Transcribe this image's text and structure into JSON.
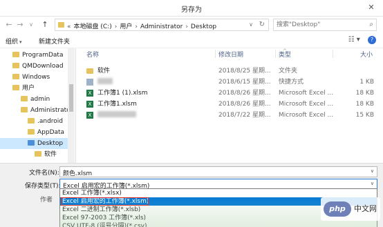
{
  "window": {
    "title": "另存为",
    "close_glyph": "✕"
  },
  "nav": {
    "back_glyph": "←",
    "forward_glyph": "→",
    "recent_glyph": "∨",
    "up_glyph": "↑",
    "address_parts": [
      "«",
      "本地磁盘 (C:)",
      "›",
      "用户",
      "›",
      "Administrator",
      "›",
      "Desktop"
    ],
    "address_dropdown_glyph": "∨",
    "refresh_glyph": "↻",
    "search_placeholder": "搜索\"Desktop\"",
    "search_glyph": "⌕"
  },
  "toolbar": {
    "organize_label": "组织",
    "new_folder_label": "新建文件夹",
    "caret": "▾",
    "view_glyph": "☷ ▾",
    "help_glyph": "?"
  },
  "tree": [
    {
      "label": "ProgramData",
      "level": 1,
      "selected": false,
      "blue": false,
      "chev": ""
    },
    {
      "label": "QMDownload",
      "level": 1,
      "selected": false,
      "blue": false,
      "chev": ""
    },
    {
      "label": "Windows",
      "level": 1,
      "selected": false,
      "blue": false,
      "chev": ""
    },
    {
      "label": "用户",
      "level": 1,
      "selected": false,
      "blue": false,
      "chev": ""
    },
    {
      "label": "admin",
      "level": 2,
      "selected": false,
      "blue": false,
      "chev": ""
    },
    {
      "label": "Administrato",
      "level": 2,
      "selected": false,
      "blue": false,
      "chev": ""
    },
    {
      "label": ".android",
      "level": 3,
      "selected": false,
      "blue": false,
      "chev": ""
    },
    {
      "label": "AppData",
      "level": 3,
      "selected": false,
      "blue": false,
      "chev": ""
    },
    {
      "label": "Desktop",
      "level": 3,
      "selected": true,
      "blue": true,
      "chev": ""
    },
    {
      "label": "软件",
      "level": 4,
      "selected": false,
      "blue": false,
      "chev": ""
    }
  ],
  "columns": {
    "name": "名称",
    "date": "修改日期",
    "type": "类型",
    "size": "大小",
    "collapse_glyph": "^"
  },
  "files": [
    {
      "icon": "folder",
      "name": "软件",
      "blurred_name": false,
      "date": "2018/8/25 星期...",
      "type": "文件夹",
      "size": ""
    },
    {
      "icon": "shortcut",
      "name": "",
      "blurred_name": true,
      "date": "2018/6/15 星期...",
      "type": "快捷方式",
      "size": "1 KB"
    },
    {
      "icon": "excel",
      "name": "工作簿1 (1).xlsm",
      "blurred_name": false,
      "date": "2018/8/26 星期...",
      "type": "Microsoft Excel ...",
      "size": "18 KB"
    },
    {
      "icon": "excel",
      "name": "工作簿1.xlsm",
      "blurred_name": false,
      "date": "2018/8/26 星期...",
      "type": "Microsoft Excel ...",
      "size": "18 KB"
    },
    {
      "icon": "excel",
      "name": "",
      "blurred_name": true,
      "date": "2018/7/22 星期...",
      "type": "Microsoft Excel ...",
      "size": "15 KB"
    }
  ],
  "form": {
    "filename_label": "文件名(N):",
    "filename_value": "颜色.xlsm",
    "type_label": "保存类型(T):",
    "type_value": "Excel 启用宏的工作簿(*.xlsm)",
    "author_label": "作者",
    "dropdown_glyph": "∨"
  },
  "type_options": [
    {
      "label": "Excel 工作簿(*.xlsx)",
      "selected": false,
      "highlighted": false
    },
    {
      "label": "Excel 启用宏的工作簿(*.xlsm)",
      "selected": true,
      "highlighted": true
    },
    {
      "label": "Excel 二进制工作簿(*.xlsb)",
      "selected": false,
      "highlighted": false
    },
    {
      "label": "Excel 97-2003 工作簿(*.xls)",
      "selected": false,
      "highlighted": false
    },
    {
      "label": "CSV UTF-8 (逗号分隔)(*.csv)",
      "selected": false,
      "highlighted": false
    }
  ],
  "watermark": {
    "logo": "php",
    "text": "中文网"
  },
  "colors": {
    "accent": "#0078d7",
    "highlight_border": "#e02020",
    "folder": "#e7c35d",
    "excel": "#1f7a45"
  }
}
